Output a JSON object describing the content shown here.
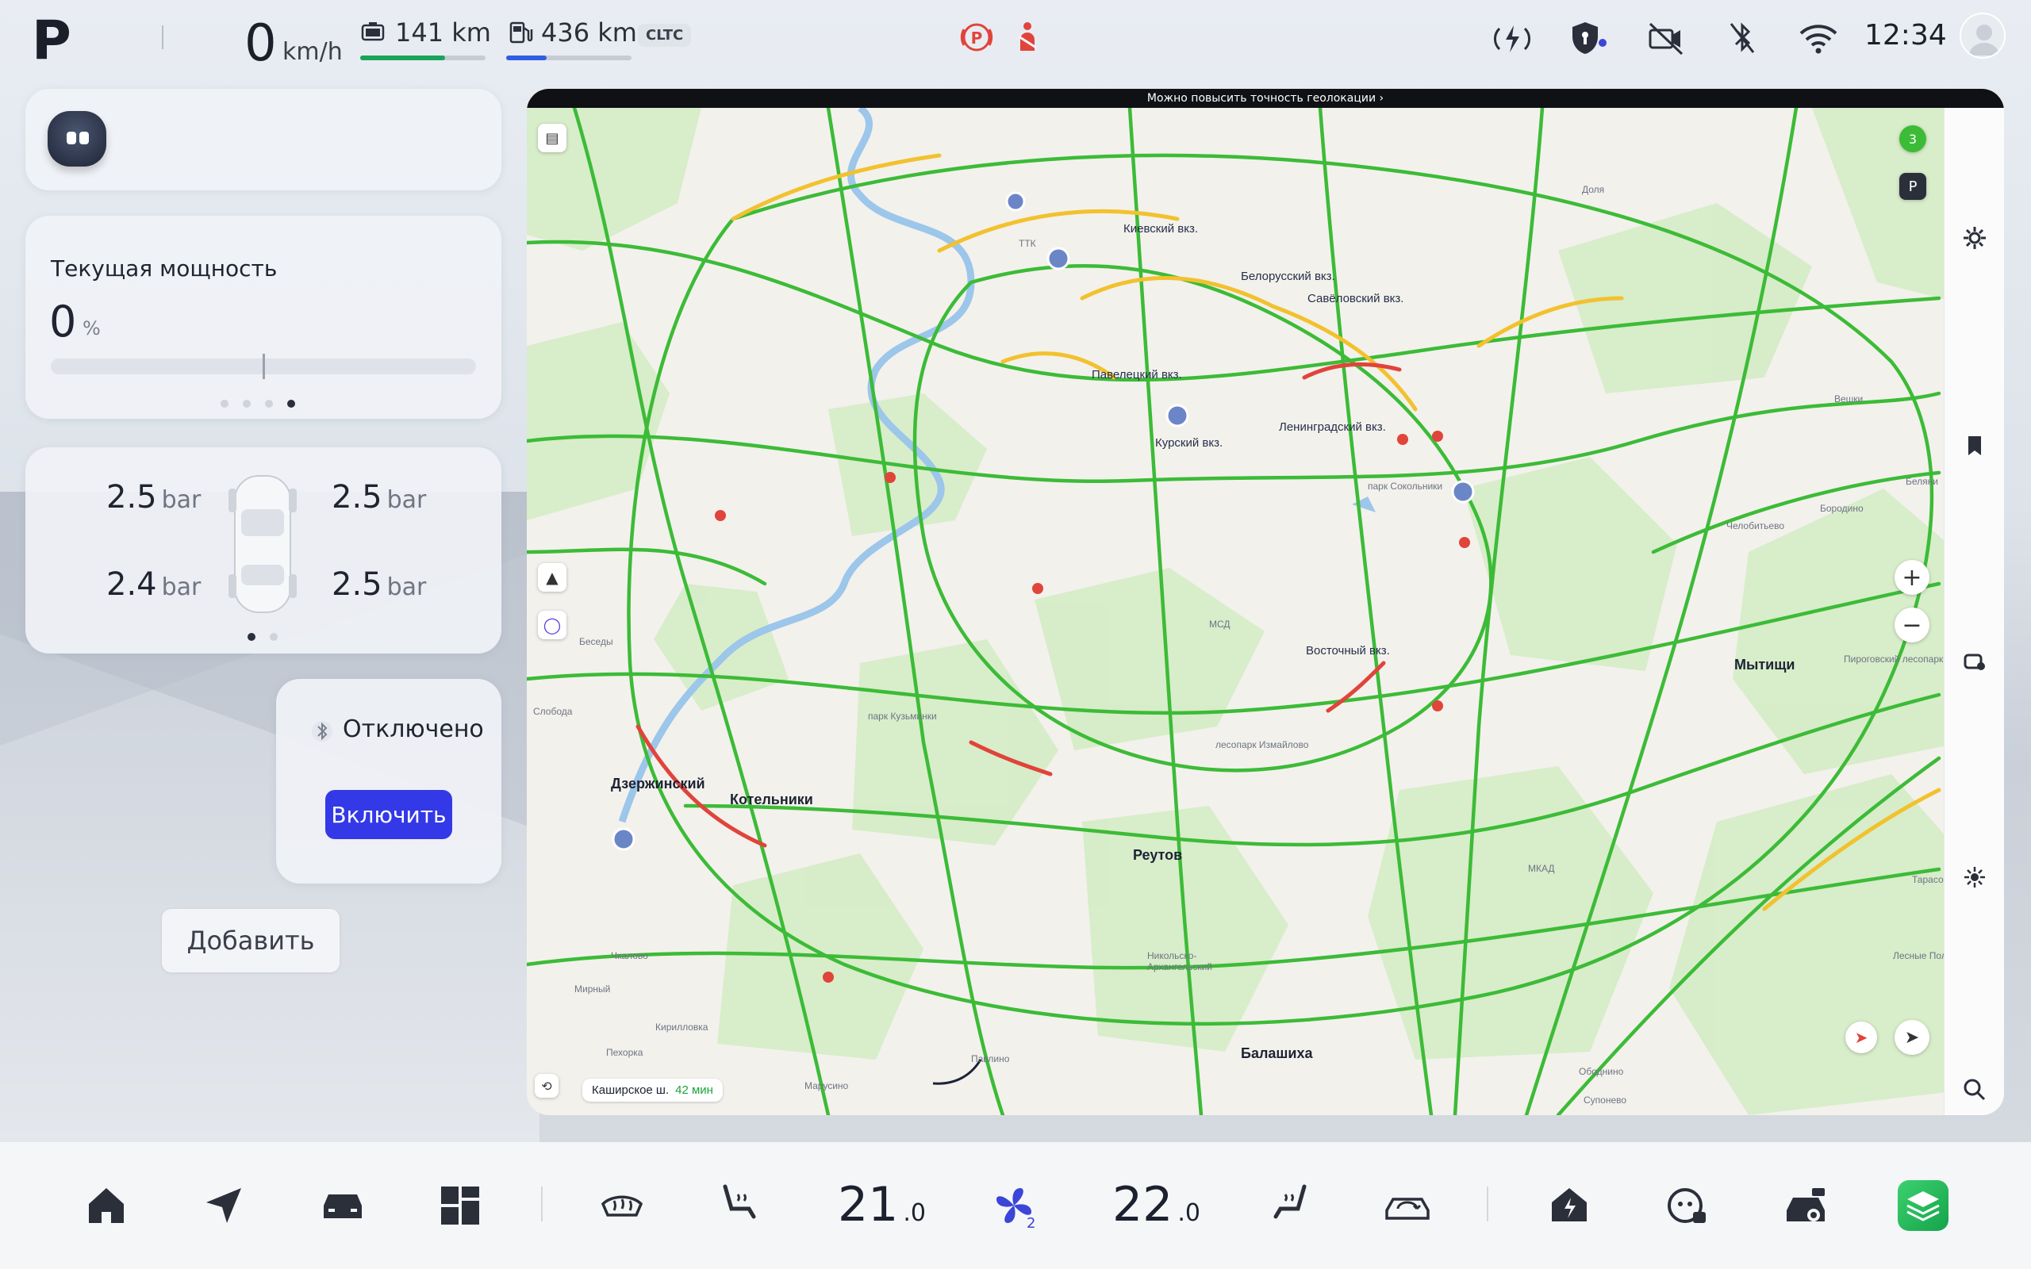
{
  "status": {
    "gear": "P",
    "speed": "0",
    "speed_unit": "km/h",
    "range1": "141 km",
    "range1_fill": 0.68,
    "range2": "436 km",
    "range2_fill": 0.32,
    "cycle": "CLTC",
    "time": "12:34"
  },
  "power_card": {
    "title": "Текущая мощность",
    "value": "0",
    "unit": "%",
    "level": 0
  },
  "tires": {
    "front_left": "2.5",
    "front_right": "2.5",
    "rear_left": "2.4",
    "rear_right": "2.5",
    "unit": "bar"
  },
  "bluetooth_card": {
    "status": "Отключено",
    "button": "Включить"
  },
  "add_button": "Добавить",
  "map": {
    "banner": "Можно повысить точность геолокации  ›",
    "route_road": "Каширское ш.",
    "route_time": "42 мин",
    "badge_count": "3",
    "labels": {
      "kievsky": "Киевский вкз.",
      "belorussky": "Белорусский вкз.",
      "savelovsky": "Савёловский вкз.",
      "paveletsky": "Павелецкий вкз.",
      "kursky": "Курский вкз.",
      "leningradsky": "Ленинградский вкз.",
      "vostochny": "Восточный вкз.",
      "dzerzhinsky": "Дзержинский",
      "kotelniki": "Котельники",
      "reutov": "Реутов",
      "mytishchi": "Мытищи",
      "balashikha": "Балашиха",
      "nikolsko": "Никольско-\nАрхангельский",
      "mkad": "МКАД",
      "ttk": "ТТК",
      "msd": "МСД",
      "park_kuzminki": "парк Кузьминки",
      "park_sokolniki": "парк Сокольники",
      "lesopark": "лесопарк Измайлово",
      "dolgoprudny": "Доля",
      "beresy": "Беседы",
      "sloboda": "Слобода",
      "pekhora": "Пехорка",
      "mirny": "Мирный",
      "chkalovo": "Чкалово",
      "kirillovka": "Кирилловка",
      "pavlino": "Павлино",
      "marusino": "Марусино",
      "obodnino": "Ободнино",
      "suponevo": "Супонево",
      "beliani": "Беляни",
      "chelobitevo": "Челобитьево",
      "borodino": "Бородино",
      "veshki": "Вешки",
      "tarasovka": "Тарасо",
      "lesnye": "Лесные Пол",
      "pirogovsky": "Пироговский лесопарк"
    }
  },
  "dock": {
    "temp_left": "21",
    "temp_left_dec": ".0",
    "fan_level": "2",
    "temp_right": "22",
    "temp_right_dec": ".0"
  },
  "colors": {
    "accent": "#3339e6",
    "traffic_green": "#3cbb37",
    "traffic_yellow": "#f2c12e",
    "traffic_red": "#e0443a",
    "range1_bar": "#1aa35a",
    "range2_bar": "#2f5fe0"
  }
}
